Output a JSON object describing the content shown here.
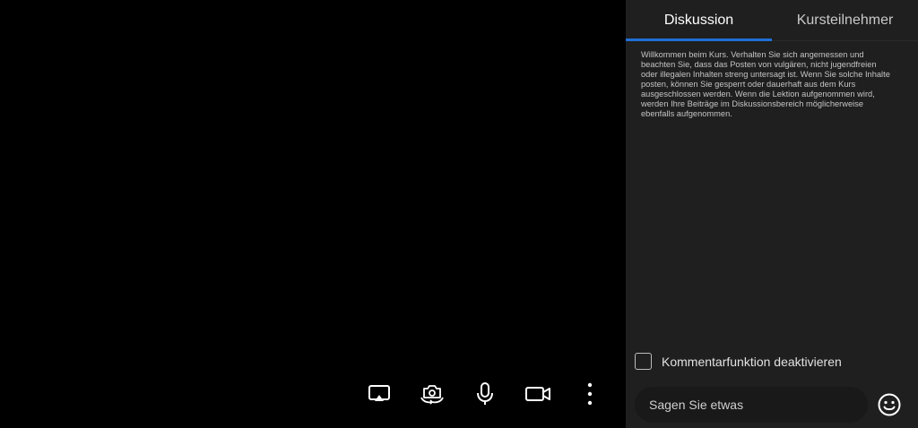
{
  "toolbar": {
    "buttons": [
      {
        "name": "screen-share-button",
        "icon": "cast-icon"
      },
      {
        "name": "switch-camera-button",
        "icon": "camera-rotate-icon"
      },
      {
        "name": "microphone-button",
        "icon": "microphone-icon"
      },
      {
        "name": "video-button",
        "icon": "video-camera-icon"
      },
      {
        "name": "more-options-button",
        "icon": "more-vertical-icon"
      }
    ]
  },
  "panel": {
    "tabs": [
      {
        "label": "Diskussion",
        "active": true
      },
      {
        "label": "Kursteilnehmer",
        "active": false
      }
    ],
    "accent_color": "#1f6fd6",
    "welcome_message": "Willkommen beim Kurs. Verhalten Sie sich angemessen und beachten Sie, dass das Posten von vulgären, nicht jugendfreien oder illegalen Inhalten streng untersagt ist. Wenn Sie solche Inhalte posten, können Sie gesperrt oder dauerhaft aus dem Kurs ausgeschlossen werden. Wenn die Lektion aufgenommen wird, werden Ihre Beiträge im Diskussionsbereich möglicherweise ebenfalls aufgenommen.",
    "disable_comments_label": "Kommentarfunktion deaktivieren",
    "disable_comments_checked": false,
    "input": {
      "placeholder": "Sagen Sie etwas",
      "value": ""
    }
  }
}
